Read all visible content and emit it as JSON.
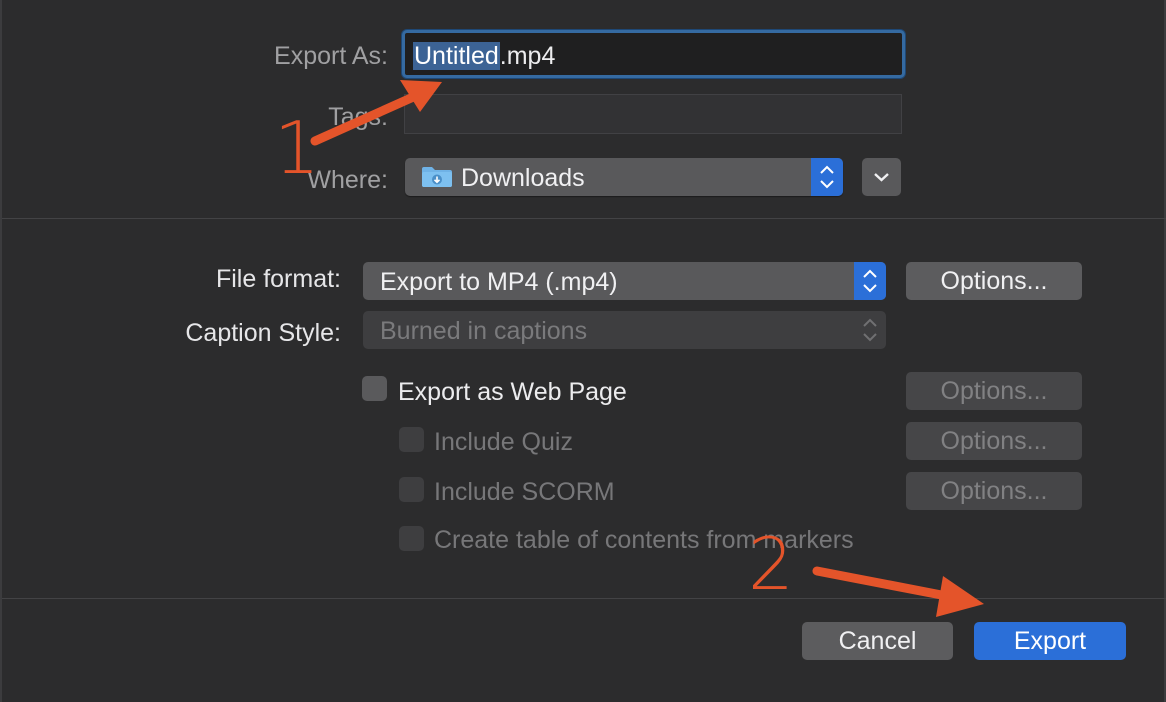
{
  "export": {
    "label": "Export As:",
    "filename_selected": "Untitled",
    "filename_ext": ".mp4"
  },
  "tags": {
    "label": "Tags:"
  },
  "where": {
    "label": "Where:",
    "value": "Downloads",
    "folder_icon": "downloads-folder-icon"
  },
  "file_format": {
    "label": "File format:",
    "value": "Export to MP4 (.mp4)",
    "options_label": "Options..."
  },
  "caption_style": {
    "label": "Caption Style:",
    "value": "Burned in captions"
  },
  "web_page": {
    "label": "Export as Web Page",
    "checked": false,
    "options_label": "Options..."
  },
  "quiz": {
    "label": "Include Quiz",
    "checked": false,
    "options_label": "Options..."
  },
  "scorm": {
    "label": "Include SCORM",
    "checked": false,
    "options_label": "Options..."
  },
  "toc": {
    "label": "Create table of contents from markers",
    "checked": false
  },
  "buttons": {
    "cancel": "Cancel",
    "export": "Export"
  },
  "annotations": {
    "step1": "1",
    "step2": "2",
    "color": "#e4542a"
  },
  "colors": {
    "accent": "#2b6fd8",
    "background": "#2c2c2d"
  }
}
